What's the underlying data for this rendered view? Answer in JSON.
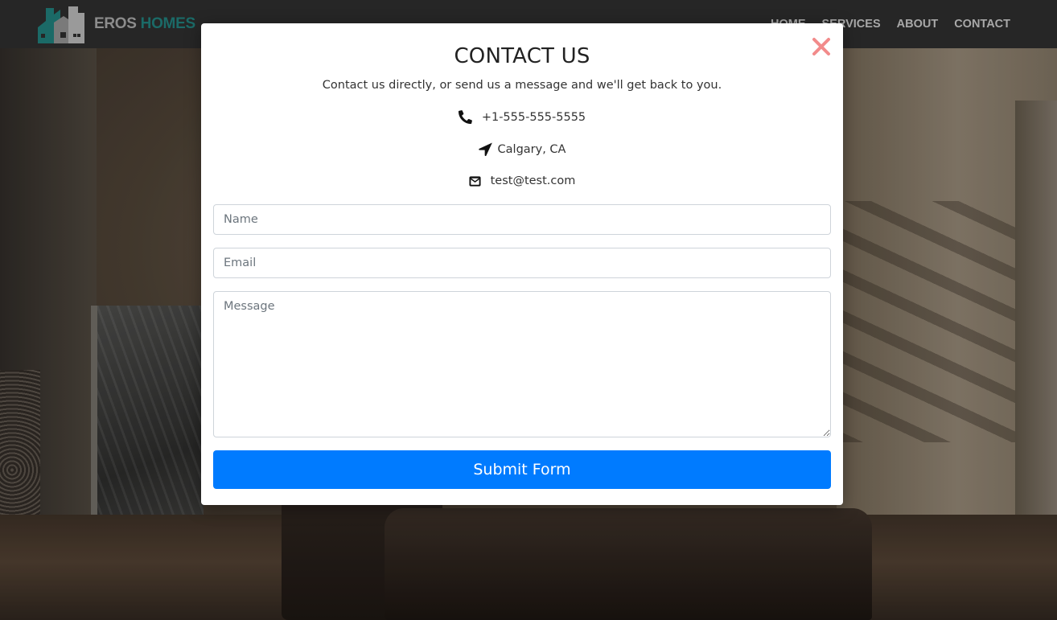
{
  "navbar": {
    "brand_word_1": "EROS",
    "brand_word_2": "HOMES",
    "links": [
      "HOME",
      "SERVICES",
      "ABOUT",
      "CONTACT"
    ]
  },
  "modal": {
    "title": "CONTACT US",
    "subtitle": "Contact us directly, or send us a message and we'll get back to you.",
    "close_icon": "close-x-icon",
    "phone": {
      "icon": "phone-icon",
      "text": "+1-555-555-5555"
    },
    "location": {
      "icon": "location-arrow-icon",
      "text": "Calgary, CA"
    },
    "email": {
      "icon": "envelope-icon",
      "text": "test@test.com"
    },
    "form": {
      "name_placeholder": "Name",
      "email_placeholder": "Email",
      "message_placeholder": "Message",
      "submit_label": "Submit Form"
    }
  },
  "colors": {
    "navbar_bg": "#262626",
    "brand_accent": "#1b6a67",
    "submit_bg": "#007bff",
    "close_color": "#f28b8b"
  }
}
